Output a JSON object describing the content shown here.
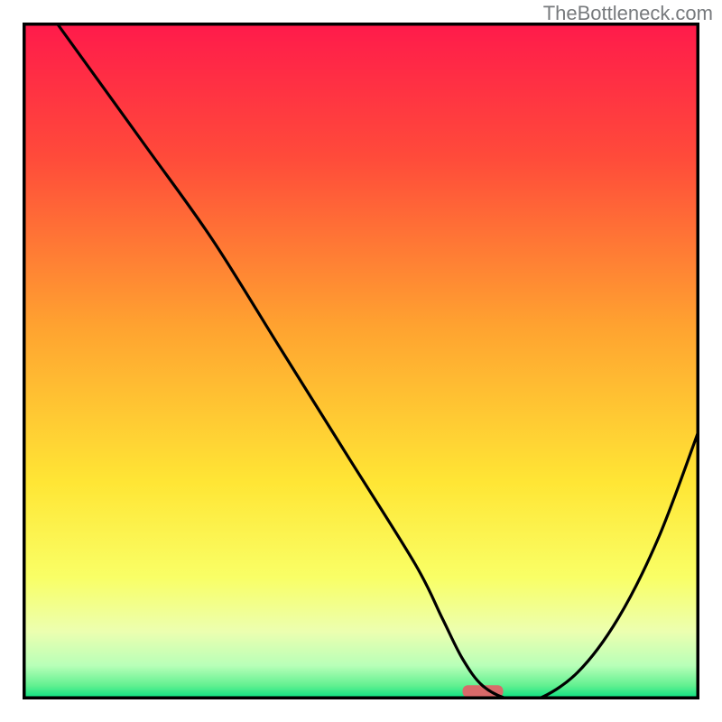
{
  "watermark": "TheBottleneck.com",
  "chart_data": {
    "type": "line",
    "title": "",
    "xlabel": "",
    "ylabel": "",
    "xlim": [
      0,
      100
    ],
    "ylim": [
      0,
      100
    ],
    "gradient_stops": [
      {
        "offset": 0,
        "color": "#ff1a4b"
      },
      {
        "offset": 20,
        "color": "#ff4b3a"
      },
      {
        "offset": 45,
        "color": "#ffa330"
      },
      {
        "offset": 68,
        "color": "#ffe635"
      },
      {
        "offset": 82,
        "color": "#f9ff66"
      },
      {
        "offset": 90,
        "color": "#ecffb0"
      },
      {
        "offset": 95,
        "color": "#b8ffb8"
      },
      {
        "offset": 98,
        "color": "#60f090"
      },
      {
        "offset": 100,
        "color": "#00e080"
      }
    ],
    "curve": {
      "x": [
        5,
        18,
        28,
        38,
        48,
        58,
        62,
        65,
        68,
        72,
        76,
        82,
        88,
        94,
        100
      ],
      "y": [
        100,
        82,
        68,
        52,
        36,
        20,
        12,
        6,
        2,
        0,
        0,
        4,
        12,
        24,
        40
      ]
    },
    "marker": {
      "x": 68,
      "y": 1.2,
      "color": "#d96a6a",
      "width": 6,
      "height": 1.8
    }
  }
}
